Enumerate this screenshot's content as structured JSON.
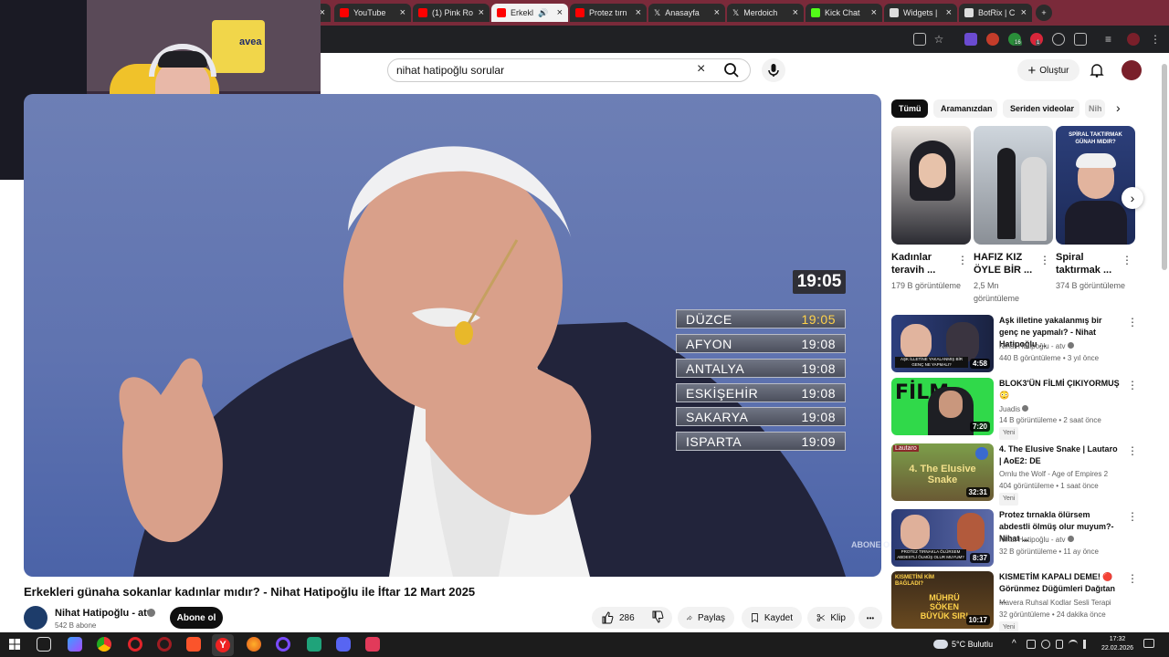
{
  "browser": {
    "tabs": [
      {
        "label": "",
        "active": false
      },
      {
        "label": "YouTube",
        "active": false
      },
      {
        "label": "(1) Pink Ro",
        "active": false
      },
      {
        "label": "Erkekl",
        "active": true
      },
      {
        "label": "Protez tırn",
        "active": false
      },
      {
        "label": "Anasayfa",
        "active": false
      },
      {
        "label": "Merdoich",
        "active": false
      },
      {
        "label": "Kick Chat",
        "active": false
      },
      {
        "label": "Widgets |",
        "active": false
      },
      {
        "label": "BotRix | C",
        "active": false
      }
    ],
    "new_tab": "+",
    "extension_badges": {
      "first": "16",
      "second": "1"
    }
  },
  "header": {
    "search_value": "nihat hatipoğlu sorular",
    "clear_icon": "×",
    "create_label": "Oluştur",
    "create_icon": "+"
  },
  "video": {
    "title": "Erkekleri günaha sokanlar kadınlar mıdır? - Nihat Hatipoğlu ile İftar 12 Mart 2025",
    "overlay_clock": "19:05",
    "prayer_times": [
      {
        "city": "DÜZCE",
        "time": "19:05"
      },
      {
        "city": "AFYON",
        "time": "19:08"
      },
      {
        "city": "ANTALYA",
        "time": "19:08"
      },
      {
        "city": "ESKİŞEHİR",
        "time": "19:08"
      },
      {
        "city": "SAKARYA",
        "time": "19:08"
      },
      {
        "city": "ISPARTA",
        "time": "19:09"
      }
    ],
    "watermark": "ABONE OL"
  },
  "channel": {
    "name": "Nihat Hatipoğlu - atv",
    "subscribers": "542 B abone",
    "subscribe_label": "Abone ol"
  },
  "actions": {
    "likes": "286",
    "share": "Paylaş",
    "save": "Kaydet",
    "clip": "Klip",
    "more": "•••"
  },
  "chips": [
    "Tümü",
    "Aramanızdan",
    "Seriden videolar",
    "Nih"
  ],
  "shorts": [
    {
      "title": "Kadınlar teravih ...",
      "views": "179 B görüntüleme",
      "more": "⋮"
    },
    {
      "title": "HAFIZ KIZ ÖYLE BİR ...",
      "views": "2,5 Mn görüntüleme",
      "more": "⋮"
    },
    {
      "title": "Spiral taktırmak ...",
      "views": "374 B görüntüleme",
      "more": "⋮",
      "thumb_text": "SPİRAL TAKTIRMAK GÜNAH MIDIR?"
    }
  ],
  "related": [
    {
      "title": "Aşk illetine yakalanmış bir genç ne yapmalı? - Nihat Hatipoğlu ...",
      "channel": "Nihat Hatipoğlu - atv",
      "meta": "440 B görüntüleme • 3 yıl önce",
      "duration": "4:58",
      "new": "",
      "thumb_text": "AŞK İLLETİNE YAKALANMIŞ BİR GENÇ NE YAPMALI?"
    },
    {
      "title": "BLOK3'ÜN FİLMİ ÇIKIYORMUŞ 😳",
      "channel": "Juadis",
      "meta": "14 B görüntüleme • 2 saat önce",
      "duration": "7:20",
      "new": "Yeni",
      "thumb_text": "FİLM"
    },
    {
      "title": "4. The Elusive Snake | Lautaro | AoE2: DE",
      "channel": "Ornlu the Wolf - Age of Empires 2",
      "meta": "404 görüntüleme • 1 saat önce",
      "duration": "32:31",
      "new": "Yeni",
      "thumb_text": "4. The Elusive Snake",
      "thumb_tag": "Lautaro"
    },
    {
      "title": "Protez tırnakla ölürsem abdestli ölmüş olur muyum?- Nihat ...",
      "channel": "Nihat Hatipoğlu - atv",
      "meta": "32 B görüntüleme • 11 ay önce",
      "duration": "8:37",
      "new": "",
      "thumb_text": "PROTEZ TIRNAKLA ÖLÜRSEM ABDESTLİ ÖLMÜŞ OLUR MUYUM?"
    },
    {
      "title": "KISMETİM KAPALI DEME! 🔴 Görünmez Düğümleri Dağıtan ...",
      "channel": "Mavera Ruhsal Kodlar Sesli Terapi",
      "meta": "32 görüntüleme • 24 dakika önce",
      "duration": "10:17",
      "new": "Yeni",
      "thumb_text": "MÜHRÜ SÖKEN BÜYÜK SIR!",
      "thumb_tag": "KISMETİNİ KİM BAĞLADI?"
    }
  ],
  "taskbar": {
    "weather": "5°C  Bulutlu",
    "time": "17:32",
    "date": "22.02.2026"
  },
  "webcam": {
    "jersey_text": "avea"
  },
  "colors": {
    "tab_strip": "#7a2a3a",
    "yt_red": "#ff0000",
    "prayer_highlight": "#ffd24a",
    "video_bg": "#5f73b0"
  }
}
